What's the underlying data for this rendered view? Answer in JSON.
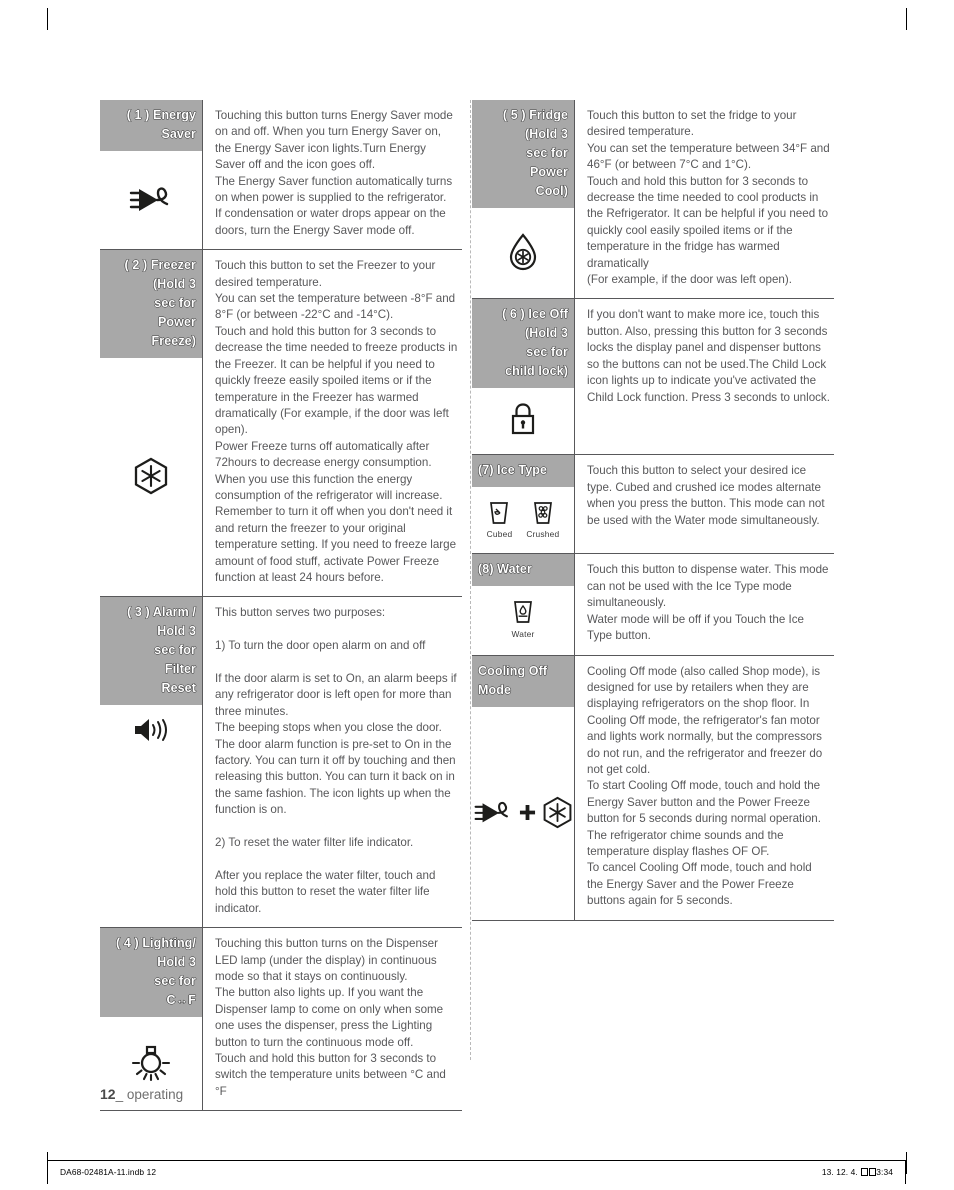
{
  "page": {
    "folio_number": "12",
    "folio_label": "_ operating"
  },
  "printer_marks": {
    "filename": "DA68-02481A-11.indb   12",
    "date": "13. 12. 4.",
    "time": "3:34"
  },
  "left_column": [
    {
      "id": "energy-saver",
      "number": "( 1 )",
      "title": "( 1 ) Energy\nSaver",
      "icon": "plug-leaf-icon",
      "description": "Touching this button turns Energy Saver mode on and off. When you turn Energy Saver on, the Energy Saver icon lights.Turn Energy Saver off and the icon goes off.\nThe Energy Saver function automatically turns on when power is supplied to the refrigerator.\nIf condensation or water drops appear on the doors, turn the Energy Saver mode off."
    },
    {
      "id": "freezer",
      "number": "( 2 )",
      "title": "( 2 ) Freezer\n(Hold 3\nsec for\nPower\nFreeze)",
      "icon": "snowflake-hex-icon",
      "description": "Touch this button to set the Freezer to your desired temperature.\nYou can set the temperature between -8°F and 8°F (or between -22°C and -14°C).\nTouch and hold this button for 3 seconds to decrease the time needed to freeze products in the Freezer. It can be helpful if you need to quickly freeze easily spoiled items or if the temperature in the Freezer has warmed dramatically (For example, if the door was left open).\nPower Freeze turns off automatically after 72hours to decrease energy consumption. When you use this function the energy consumption of the refrigerator will increase. Remember to turn it off when you don't need it and return the freezer to your original temperature setting. If you need to freeze large amount of food stuff, activate Power Freeze function at least 24 hours before."
    },
    {
      "id": "alarm-filter-reset",
      "number": "( 3 )",
      "title": "( 3 ) Alarm /\nHold 3\nsec for\nFilter\nReset",
      "icon": "speaker-icon",
      "description": "This button serves two purposes:\n\n1) To turn the door open alarm on and off\n\nIf the door alarm is set to On, an alarm beeps if any refrigerator door is left open for more than three minutes.\nThe beeping stops when you close the door. The door alarm function is pre-set to On in the factory. You can turn it off by touching and then releasing this button. You can turn it back on in the same fashion. The icon lights up when the function is on.\n\n2) To reset the water filter life indicator.\n\nAfter you replace the water filter, touch and hold this button to reset the water filter life indicator."
    },
    {
      "id": "lighting",
      "number": "( 4 )",
      "title": "( 4 ) Lighting/\nHold 3\nsec for\nC↔F",
      "icon": "light-bulb-icon",
      "description": "Touching this button turns on the Dispenser LED lamp (under the display) in continuous mode so that it stays on continuously.\nThe button also lights up. If you want the Dispenser lamp to come on only when some one uses the dispenser, press the Lighting button to turn the continuous mode off.\nTouch and hold this button for 3 seconds to switch the temperature units between °C and °F"
    }
  ],
  "right_column": [
    {
      "id": "fridge",
      "number": "( 5 )",
      "title": "( 5 ) Fridge\n(Hold 3\nsec for\nPower\nCool)",
      "icon": "droplet-snowflake-icon",
      "description": "Touch this button to set the fridge to your desired temperature.\nYou can set the temperature between 34°F and 46°F (or between 7°C and 1°C).\nTouch and hold this button for 3 seconds to decrease the time needed to cool products in the Refrigerator. It can be helpful if you need to quickly cool easily spoiled items or if the temperature in the fridge has warmed dramatically\n(For example, if the door was left open)."
    },
    {
      "id": "ice-off",
      "number": "( 6 )",
      "title": "( 6 ) Ice Off\n(Hold 3\nsec for\nchild lock)",
      "icon": "padlock-icon",
      "description": "If you don't want to make more ice, touch this button. Also, pressing this button for 3 seconds locks the display panel and dispenser buttons so the buttons can not be used.The Child Lock icon lights up to indicate you've activated the Child Lock function. Press 3 seconds to unlock."
    },
    {
      "id": "ice-type",
      "number": "(7)",
      "title": "(7) Ice Type",
      "icon": "ice-glasses-icon",
      "icon_captions": [
        "Cubed",
        "Crushed"
      ],
      "description": "Touch this button to select your desired ice type. Cubed and crushed ice modes alternate when you press the button. This mode can not be used with the Water mode simultaneously."
    },
    {
      "id": "water",
      "number": "(8)",
      "title": "(8) Water",
      "icon": "water-glass-icon",
      "icon_captions": [
        "Water"
      ],
      "description": "Touch this button to dispense water. This mode can not be used with the Ice Type mode simultaneously.\nWater mode will be off if you Touch the Ice Type button."
    },
    {
      "id": "cooling-off-mode",
      "number": "",
      "title": "Cooling Off\nMode",
      "icon": "plug-plus-snowflake-icon",
      "description": "Cooling Off mode (also called Shop mode), is designed for use by retailers when they are displaying refrigerators on the shop floor. In Cooling Off mode, the refrigerator's fan motor and lights work normally, but the compressors do not run, and the refrigerator and freezer do not get cold.\nTo start Cooling Off mode, touch and hold the Energy Saver button and the Power Freeze button for 5 seconds during normal operation. The refrigerator chime sounds and the temperature display flashes OF OF.\nTo cancel Cooling Off mode, touch and hold the Energy Saver and the Power Freeze buttons again for 5 seconds."
    }
  ],
  "colors": {
    "header_bg": "#a8a8a8",
    "body_text": "#58585a",
    "rule": "#58585a"
  }
}
